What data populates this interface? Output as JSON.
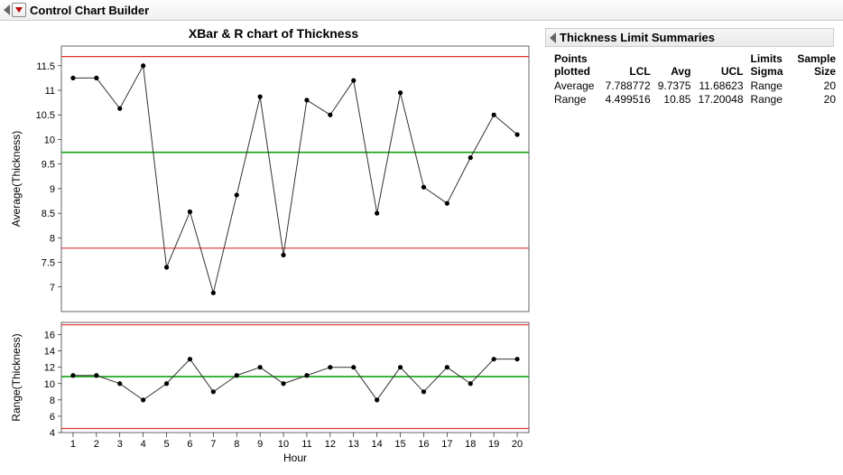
{
  "header": {
    "title": "Control Chart Builder"
  },
  "chart_title": "XBar & R chart of Thickness",
  "axis": {
    "x_label": "Hour",
    "y1_label": "Average(Thickness)",
    "y2_label": "Range(Thickness)"
  },
  "side_panel": {
    "title": "Thickness Limit Summaries",
    "columns": [
      "Points plotted",
      "LCL",
      "Avg",
      "UCL",
      "Limits Sigma",
      "Sample Size"
    ],
    "rows": [
      {
        "name": "Average",
        "lcl": "7.788772",
        "avg": "9.7375",
        "ucl": "11.68623",
        "sigma": "Range",
        "n": "20"
      },
      {
        "name": "Range",
        "lcl": "4.499516",
        "avg": "10.85",
        "ucl": "17.20048",
        "sigma": "Range",
        "n": "20"
      }
    ]
  },
  "chart_data": [
    {
      "type": "line",
      "name": "XBar",
      "xlabel": "Hour",
      "ylabel": "Average(Thickness)",
      "x": [
        1,
        2,
        3,
        4,
        5,
        6,
        7,
        8,
        9,
        10,
        11,
        12,
        13,
        14,
        15,
        16,
        17,
        18,
        19,
        20
      ],
      "values": [
        11.25,
        11.25,
        10.63,
        11.5,
        7.4,
        8.53,
        6.88,
        8.87,
        10.87,
        7.65,
        10.8,
        10.5,
        11.2,
        8.5,
        10.95,
        9.03,
        8.7,
        9.63,
        10.5,
        10.1
      ],
      "center": 9.7375,
      "lcl": 7.788772,
      "ucl": 11.68623,
      "ylim": [
        6.5,
        11.9
      ],
      "yticks": [
        7.0,
        7.5,
        8.0,
        8.5,
        9.0,
        9.5,
        10.0,
        10.5,
        11.0,
        11.5
      ]
    },
    {
      "type": "line",
      "name": "R",
      "xlabel": "Hour",
      "ylabel": "Range(Thickness)",
      "x": [
        1,
        2,
        3,
        4,
        5,
        6,
        7,
        8,
        9,
        10,
        11,
        12,
        13,
        14,
        15,
        16,
        17,
        18,
        19,
        20
      ],
      "values": [
        11.0,
        11.0,
        10.0,
        8.0,
        10.0,
        13.0,
        9.0,
        11.0,
        12.0,
        10.0,
        11.0,
        12.0,
        12.0,
        8.0,
        12.0,
        9.0,
        12.0,
        10.0,
        13.0,
        13.0
      ],
      "center": 10.85,
      "lcl": 4.499516,
      "ucl": 17.20048,
      "ylim": [
        4,
        17.5
      ],
      "yticks": [
        4,
        6,
        8,
        10,
        12,
        14,
        16
      ]
    }
  ]
}
